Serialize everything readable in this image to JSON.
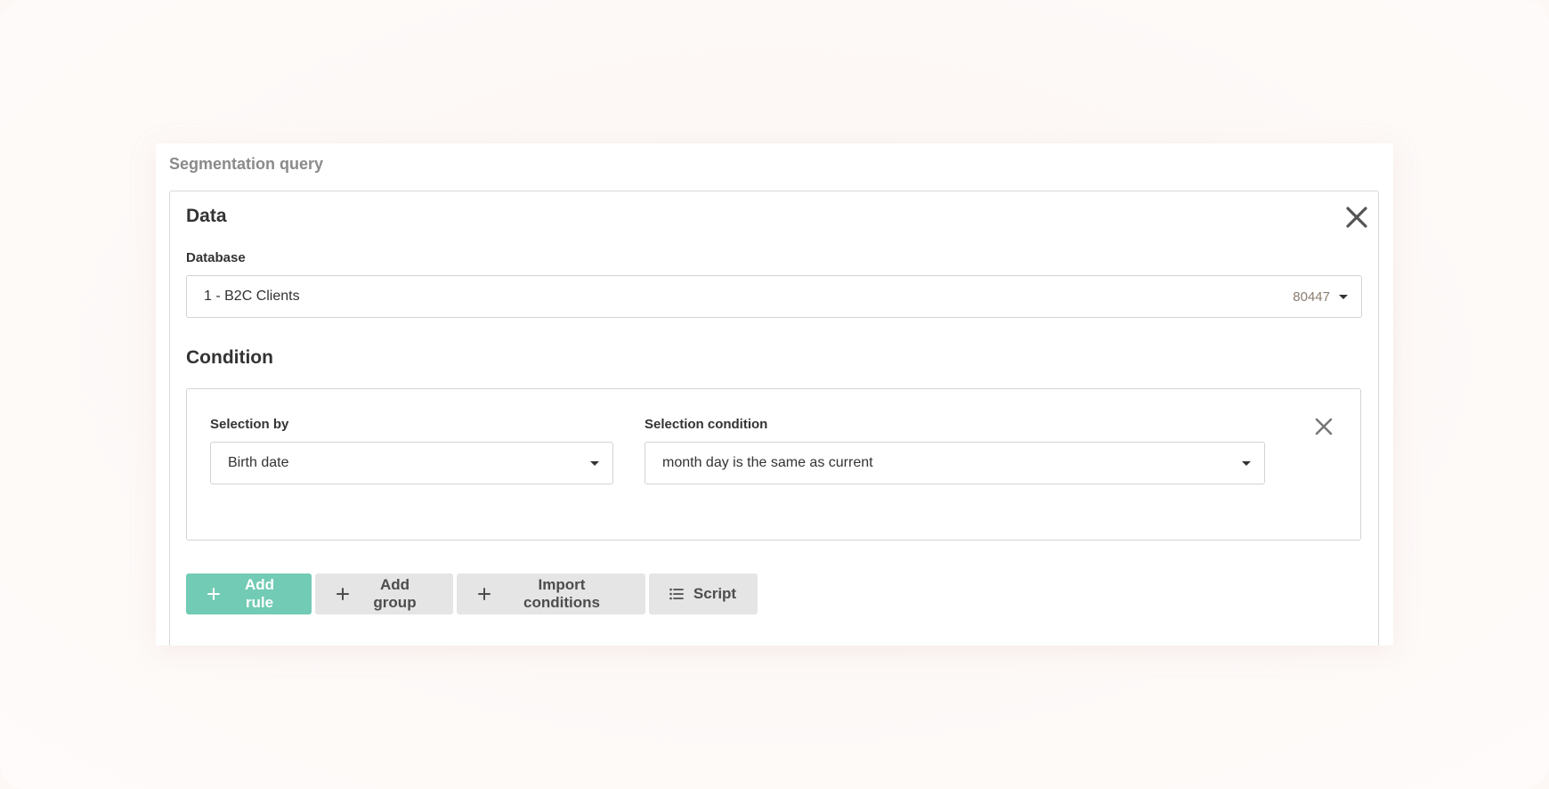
{
  "panel": {
    "label": "Segmentation query"
  },
  "data_card": {
    "title": "Data",
    "database": {
      "label": "Database",
      "value": "1 - B2C Clients",
      "count": "80447"
    }
  },
  "condition": {
    "title": "Condition",
    "rule": {
      "selection_by": {
        "label": "Selection by",
        "value": "Birth date"
      },
      "selection_condition": {
        "label": "Selection condition",
        "value": "month day is the same as current"
      }
    }
  },
  "buttons": {
    "add_rule": "Add rule",
    "add_group": "Add group",
    "import_conditions": "Import conditions",
    "script": "Script"
  },
  "colors": {
    "primary": "#72cbb4",
    "secondary": "#e5e5e5"
  }
}
